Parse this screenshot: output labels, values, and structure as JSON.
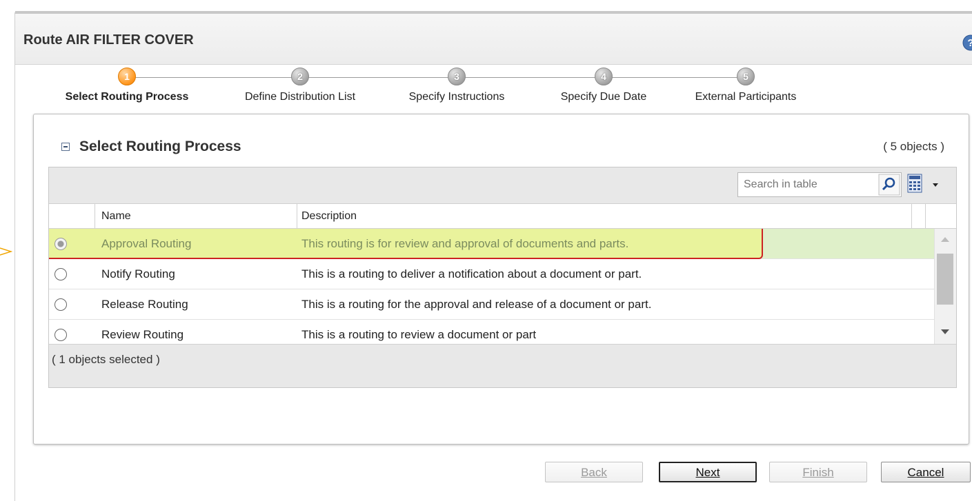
{
  "page": {
    "title": "Route AIR FILTER COVER"
  },
  "icons": {
    "help": "help-icon",
    "collapse": "collapse-icon",
    "search": "search-icon",
    "table_view": "calculator-icon",
    "menu": "chevron-down-icon",
    "pointer": "arrow-icon"
  },
  "wizard": {
    "steps": [
      {
        "number": "1",
        "label": "Select Routing Process",
        "state": "active"
      },
      {
        "number": "2",
        "label": "Define Distribution List",
        "state": "pending"
      },
      {
        "number": "3",
        "label": "Specify Instructions",
        "state": "pending"
      },
      {
        "number": "4",
        "label": "Specify Due Date",
        "state": "pending"
      },
      {
        "number": "5",
        "label": "External Participants",
        "state": "pending"
      }
    ]
  },
  "panel": {
    "title": "Select Routing Process",
    "object_count": "( 5 objects )",
    "search_placeholder": "Search in table",
    "columns": {
      "name": "Name",
      "description": "Description"
    },
    "rows": [
      {
        "name": "Approval Routing",
        "description": "This routing is for review and approval of documents and parts.",
        "selected": true
      },
      {
        "name": "Notify Routing",
        "description": "This is a routing to deliver a notification about a document or part.",
        "selected": false
      },
      {
        "name": "Release Routing",
        "description": "This is a routing for the approval and release of a document or part.",
        "selected": false
      },
      {
        "name": "Review Routing",
        "description": "This is a routing to review a document or part",
        "selected": false
      }
    ],
    "selected_count": "( 1 objects selected )"
  },
  "buttons": {
    "back": "Back",
    "next": "Next",
    "finish": "Finish",
    "cancel": "Cancel"
  },
  "colors": {
    "accent_step": "#ff9a25",
    "selected_row": "#dff0c9",
    "highlight_border": "#cc2222",
    "highlight_fill": "#f1f676"
  }
}
